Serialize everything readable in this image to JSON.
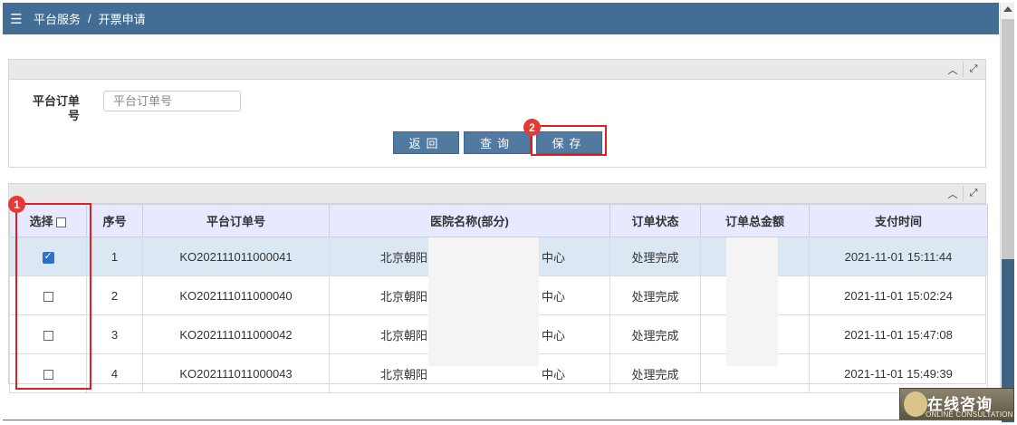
{
  "header": {
    "menu_icon": "menu-icon",
    "breadcrumb_root": "平台服务",
    "breadcrumb_sep": "/",
    "breadcrumb_current": "开票申请"
  },
  "search": {
    "label": "平台订单号",
    "placeholder": "平台订单号",
    "value": "",
    "buttons": {
      "back": "返回",
      "query": "查询",
      "save": "保存"
    },
    "tools": {
      "collapse_icon": "chevron-up-icon",
      "expand_icon": "expand-icon"
    }
  },
  "annotations": {
    "badge1": "1",
    "badge2": "2",
    "accent": "#e02020"
  },
  "table": {
    "columns": {
      "select": "选择",
      "index": "序号",
      "order_no": "平台订单号",
      "hospital": "医院名称(部分)",
      "status": "订单状态",
      "amount": "订单总金额",
      "paid_at": "支付时间"
    },
    "rows": [
      {
        "checked": true,
        "index": "1",
        "order_no": "KO202111011000041",
        "hospital_prefix": "北京朝阳",
        "hospital_suffix": "中心",
        "status": "处理完成",
        "amount": "",
        "paid_at": "2021-11-01 15:11:44"
      },
      {
        "checked": false,
        "index": "2",
        "order_no": "KO202111011000040",
        "hospital_prefix": "北京朝阳",
        "hospital_suffix": "中心",
        "status": "处理完成",
        "amount": "",
        "paid_at": "2021-11-01 15:02:24"
      },
      {
        "checked": false,
        "index": "3",
        "order_no": "KO202111011000042",
        "hospital_prefix": "北京朝阳",
        "hospital_suffix": "中心",
        "status": "处理完成",
        "amount": "",
        "paid_at": "2021-11-01 15:47:08"
      },
      {
        "checked": false,
        "index": "4",
        "order_no": "KO202111011000043",
        "hospital_prefix": "北京朝阳",
        "hospital_suffix": "中心",
        "status": "处理完成",
        "amount": "",
        "paid_at": "2021-11-01 15:49:39"
      }
    ]
  },
  "watermark": {
    "main": "在线咨询",
    "sub": "ONLINE CONSULTATION"
  },
  "colors": {
    "topbar": "#426d95",
    "button": "#527aa1",
    "header_row": "#e6e9ff",
    "selected_row": "#dbe7f3"
  }
}
